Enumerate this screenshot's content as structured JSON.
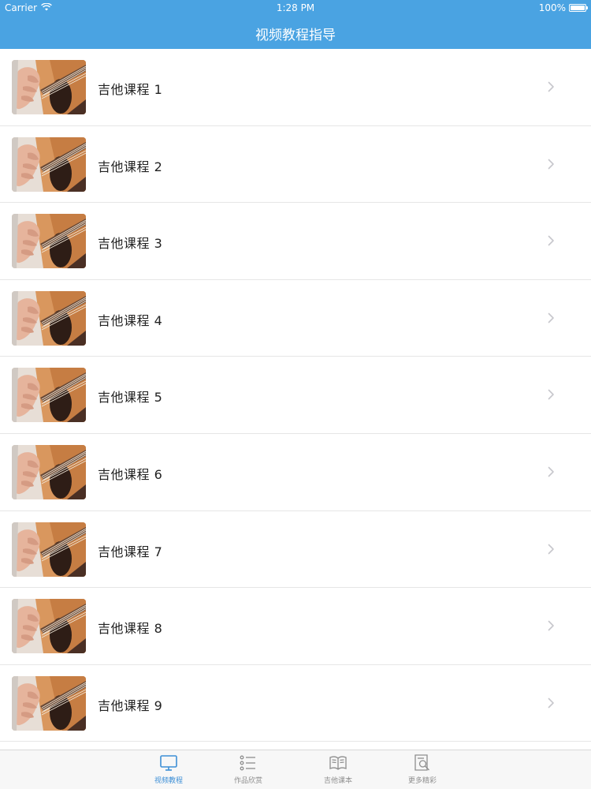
{
  "status_bar": {
    "carrier": "Carrier",
    "time": "1:28 PM",
    "battery": "100%",
    "battery_level": 1.0
  },
  "nav": {
    "title": "视频教程指导"
  },
  "list": {
    "items": [
      {
        "label": "吉他课程 1"
      },
      {
        "label": "吉他课程 2"
      },
      {
        "label": "吉他课程 3"
      },
      {
        "label": "吉他课程 4"
      },
      {
        "label": "吉他课程 5"
      },
      {
        "label": "吉他课程 6"
      },
      {
        "label": "吉他课程 7"
      },
      {
        "label": "吉他课程 8"
      },
      {
        "label": "吉他课程 9"
      }
    ],
    "thumbnail_icon": "guitar-thumbnail",
    "disclosure_icon": "chevron-right-icon"
  },
  "tabbar": {
    "tabs": [
      {
        "label": "视频教程",
        "icon": "monitor-icon",
        "active": true
      },
      {
        "label": "作品欣赏",
        "icon": "list-icon",
        "active": false
      },
      {
        "label": "吉他课本",
        "icon": "book-icon",
        "active": false
      },
      {
        "label": "更多精彩",
        "icon": "document-search-icon",
        "active": false
      }
    ]
  },
  "colors": {
    "header_bg": "#4aa3e2",
    "tab_active": "#3d8fd6",
    "tab_inactive": "#8e8e8e"
  }
}
